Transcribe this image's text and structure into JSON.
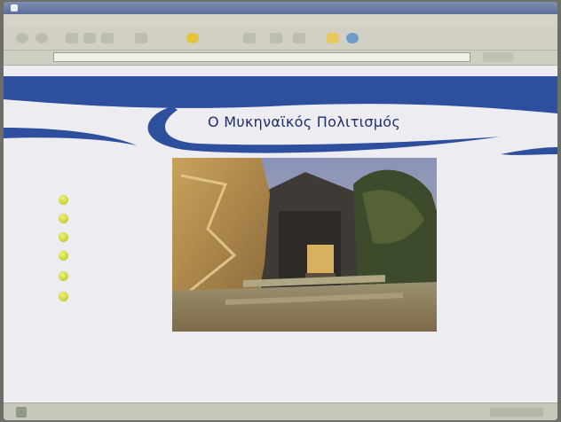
{
  "window": {
    "title": ""
  },
  "menu": {
    "items": [
      "",
      "",
      "",
      "",
      "",
      ""
    ]
  },
  "address": {
    "url": ""
  },
  "page": {
    "heading": "Ο Μυκηναϊκός Πολιτισμός",
    "nav_title": "",
    "nav_items": [
      "",
      "",
      "",
      "",
      "",
      ""
    ],
    "paragraph_lines": [
      "",
      "",
      "",
      ""
    ]
  },
  "colors": {
    "banner_blue": "#2e4f9e",
    "heading_blue": "#1f2d70",
    "bullet_green": "#c8d62a",
    "page_background": "#ececf1"
  },
  "icons": [
    "window-icon",
    "back-icon",
    "forward-icon",
    "stop-icon",
    "refresh-icon",
    "home-icon",
    "search-icon",
    "favorites-star-icon",
    "history-icon",
    "mail-icon",
    "print-icon",
    "folder-icon",
    "globe-icon"
  ]
}
